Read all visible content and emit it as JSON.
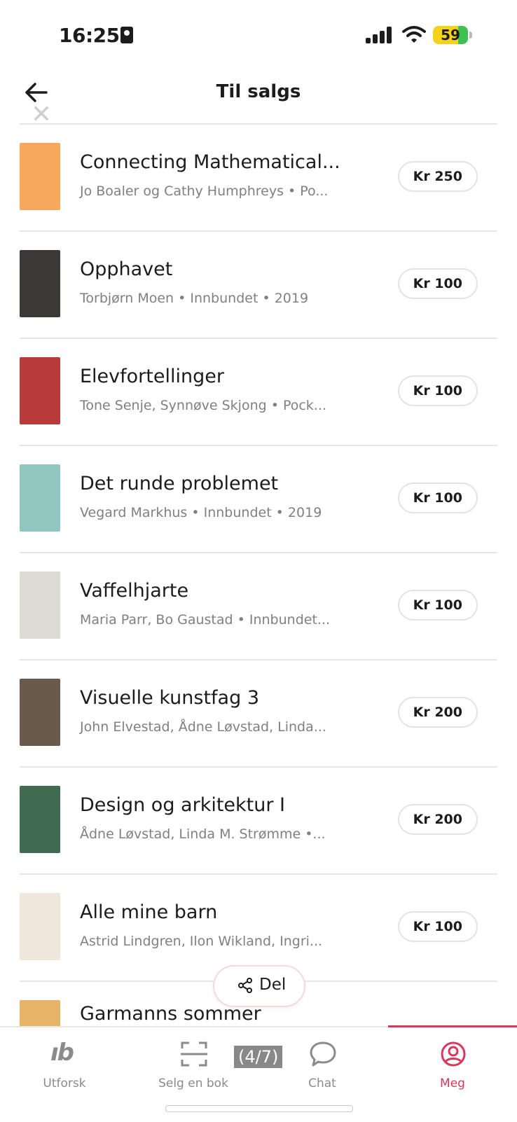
{
  "status_bar": {
    "time": "16:25",
    "battery": "59"
  },
  "header": {
    "title": "Til salgs"
  },
  "listings": [
    {
      "title": "Connecting Mathematical...",
      "meta": "Jo Boaler og Cathy Humphreys • Po...",
      "price": "Kr 250",
      "cover_color": "#f6a85c"
    },
    {
      "title": "Opphavet",
      "meta": "Torbjørn Moen • Innbundet • 2019",
      "price": "Kr 100",
      "cover_color": "#3b3a38"
    },
    {
      "title": "Elevfortellinger",
      "meta": "Tone Senje, Synnøve Skjong • Pock...",
      "price": "Kr 100",
      "cover_color": "#b83a3a"
    },
    {
      "title": "Det runde problemet",
      "meta": "Vegard Markhus • Innbundet • 2019",
      "price": "Kr 100",
      "cover_color": "#8fc6c0"
    },
    {
      "title": "Vaffelhjarte",
      "meta": "Maria Parr, Bo Gaustad • Innbundet...",
      "price": "Kr 100",
      "cover_color": "#dcdcd4"
    },
    {
      "title": "Visuelle kunstfag 3",
      "meta": "John Elvestad, Ådne Løvstad, Linda...",
      "price": "Kr 200",
      "cover_color": "#6a5a4c"
    },
    {
      "title": "Design og arkitektur I",
      "meta": "Ådne Løvstad, Linda M. Strømme •...",
      "price": "Kr 200",
      "cover_color": "#3f6b52"
    },
    {
      "title": "Alle mine barn",
      "meta": "Astrid Lindgren, Ilon Wikland, Ingri...",
      "price": "Kr 100",
      "cover_color": "#efe7dc"
    },
    {
      "title": "Garmanns sommer",
      "cover_color": "#e6b466"
    }
  ],
  "share_button": {
    "label": "Del"
  },
  "tabs": [
    {
      "label": "Utforsk",
      "icon": "ib-logo-icon"
    },
    {
      "label": "Selg en bok",
      "icon": "scan-icon"
    },
    {
      "label": "Chat",
      "icon": "chat-bubble-icon"
    },
    {
      "label": "Meg",
      "icon": "profile-icon"
    }
  ],
  "colors": {
    "accent": "#d8385b",
    "muted": "#8a8a8f"
  },
  "counter": "(4/7)"
}
